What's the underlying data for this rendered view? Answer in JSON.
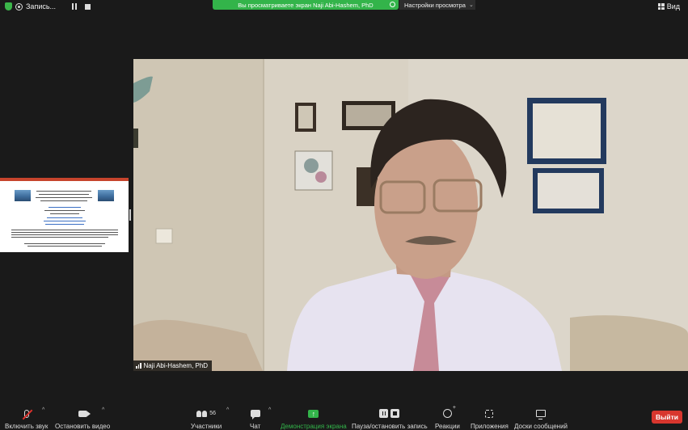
{
  "topbar": {
    "recording_label": "Запись...",
    "share_banner": "Вы просматриваете экран Naji Abi-Hashem, PhD",
    "view_options": "Настройки просмотра",
    "view_label": "Вид"
  },
  "video": {
    "participant_name": "Naji Abi-Hashem, PhD"
  },
  "toolbar": {
    "mute_label": "Включить звук",
    "video_label": "Остановить видео",
    "participants_label": "Участники",
    "participants_count": "56",
    "chat_label": "Чат",
    "share_label": "Демонстрация экрана",
    "record_label": "Пауза/остановить запись",
    "reactions_label": "Реакции",
    "apps_label": "Приложения",
    "whiteboard_label": "Доски сообщений",
    "exit_label": "Выйти"
  },
  "colors": {
    "accent_green": "#33b44a",
    "exit_red": "#d8362e",
    "background": "#1a1a1a"
  },
  "icons": [
    "shield-icon",
    "record-icon",
    "pause-icon",
    "stop-icon",
    "grid-view-icon",
    "microphone-muted-icon",
    "camera-icon",
    "participants-icon",
    "chat-icon",
    "share-screen-icon",
    "reactions-icon",
    "apps-icon",
    "whiteboard-icon"
  ]
}
